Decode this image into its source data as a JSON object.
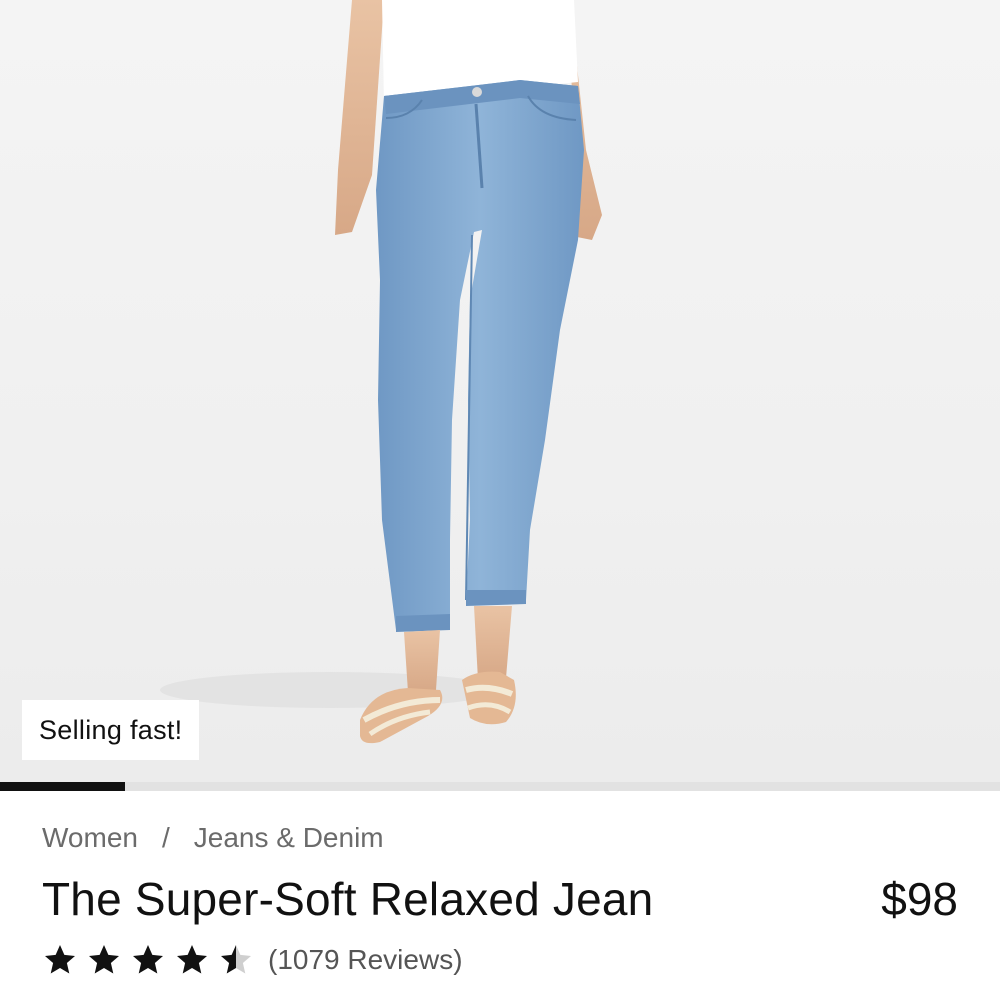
{
  "product": {
    "badge": "Selling fast!",
    "breadcrumb": [
      "Women",
      "Jeans & Denim"
    ],
    "breadcrumb_separator": "/",
    "title": "The Super-Soft Relaxed Jean",
    "price": "$98",
    "rating": 4.5,
    "rating_max": 5,
    "reviews_label": "(1079 Reviews)"
  },
  "gallery": {
    "image_description": "model-wearing-light-wash-relaxed-jeans",
    "progress_fraction": 0.125
  },
  "colors": {
    "star": "#111111",
    "star_empty": "#cfcfcf",
    "denim": "#7ea6cf",
    "progress": "#111111"
  }
}
